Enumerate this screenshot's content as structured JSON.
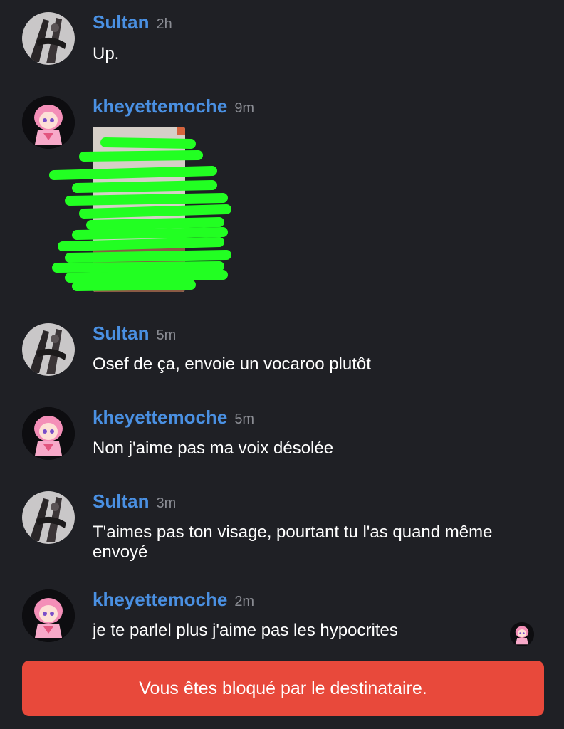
{
  "messages": [
    {
      "author": "Sultan",
      "time": "2h",
      "text": "Up.",
      "avatar": "sultan-avatar"
    },
    {
      "author": "kheyettemoche",
      "time": "9m",
      "attachment": "censored-photo",
      "avatar": "kheyettemoche-avatar"
    },
    {
      "author": "Sultan",
      "time": "5m",
      "text": "Osef de ça, envoie un vocaroo plutôt",
      "avatar": "sultan-avatar"
    },
    {
      "author": "kheyettemoche",
      "time": "5m",
      "text": "Non j'aime pas ma voix désolée",
      "avatar": "kheyettemoche-avatar"
    },
    {
      "author": "Sultan",
      "time": "3m",
      "text": "T'aimes pas ton visage, pourtant tu l'as quand même envoyé",
      "avatar": "sultan-avatar"
    },
    {
      "author": "kheyettemoche",
      "time": "2m",
      "text": "je te parlel plus j'aime pas les hypocrites",
      "avatar": "kheyettemoche-avatar"
    }
  ],
  "blocked_notice": "Vous êtes bloqué par le destinataire.",
  "colors": {
    "background": "#1f2025",
    "author": "#4a90e2",
    "timestamp": "#8a8c93",
    "banner": "#e8493b",
    "scribble": "#22ff22"
  }
}
